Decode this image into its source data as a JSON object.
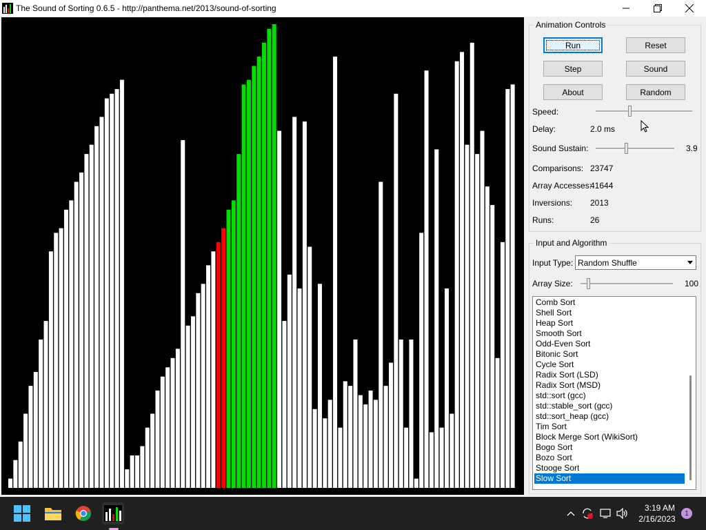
{
  "window": {
    "title": "The Sound of Sorting 0.6.5 - http://panthema.net/2013/sound-of-sorting",
    "app_icon": "sound-of-sorting-icon",
    "controls": [
      "minimize-icon",
      "maximize-icon",
      "close-icon"
    ]
  },
  "colors": {
    "background": "#000000",
    "bar_default": "#ffffff",
    "bar_red": "#ff0000",
    "bar_green": "#00dd00",
    "selection": "#0078d7"
  },
  "visualization": {
    "bars": [
      {
        "v": 2,
        "c": "w"
      },
      {
        "v": 6,
        "c": "w"
      },
      {
        "v": 10,
        "c": "w"
      },
      {
        "v": 16,
        "c": "w"
      },
      {
        "v": 22,
        "c": "w"
      },
      {
        "v": 25,
        "c": "w"
      },
      {
        "v": 32,
        "c": "w"
      },
      {
        "v": 36,
        "c": "w"
      },
      {
        "v": 51,
        "c": "w"
      },
      {
        "v": 55,
        "c": "w"
      },
      {
        "v": 56,
        "c": "w"
      },
      {
        "v": 60,
        "c": "w"
      },
      {
        "v": 62,
        "c": "w"
      },
      {
        "v": 66,
        "c": "w"
      },
      {
        "v": 68,
        "c": "w"
      },
      {
        "v": 72,
        "c": "w"
      },
      {
        "v": 74,
        "c": "w"
      },
      {
        "v": 78,
        "c": "w"
      },
      {
        "v": 80,
        "c": "w"
      },
      {
        "v": 84,
        "c": "w"
      },
      {
        "v": 85,
        "c": "w"
      },
      {
        "v": 86,
        "c": "w"
      },
      {
        "v": 88,
        "c": "w"
      },
      {
        "v": 4,
        "c": "w"
      },
      {
        "v": 7,
        "c": "w"
      },
      {
        "v": 7,
        "c": "w"
      },
      {
        "v": 9,
        "c": "w"
      },
      {
        "v": 13,
        "c": "w"
      },
      {
        "v": 16,
        "c": "w"
      },
      {
        "v": 21,
        "c": "w"
      },
      {
        "v": 24,
        "c": "w"
      },
      {
        "v": 26,
        "c": "w"
      },
      {
        "v": 28,
        "c": "w"
      },
      {
        "v": 30,
        "c": "w"
      },
      {
        "v": 75,
        "c": "w"
      },
      {
        "v": 35,
        "c": "w"
      },
      {
        "v": 37,
        "c": "w"
      },
      {
        "v": 42,
        "c": "w"
      },
      {
        "v": 44,
        "c": "w"
      },
      {
        "v": 48,
        "c": "w"
      },
      {
        "v": 51,
        "c": "w"
      },
      {
        "v": 53,
        "c": "r"
      },
      {
        "v": 56,
        "c": "r"
      },
      {
        "v": 60,
        "c": "g"
      },
      {
        "v": 62,
        "c": "g"
      },
      {
        "v": 72,
        "c": "g"
      },
      {
        "v": 87,
        "c": "g"
      },
      {
        "v": 88,
        "c": "g"
      },
      {
        "v": 91,
        "c": "g"
      },
      {
        "v": 93,
        "c": "g"
      },
      {
        "v": 96,
        "c": "g"
      },
      {
        "v": 99,
        "c": "g"
      },
      {
        "v": 100,
        "c": "g"
      },
      {
        "v": 77,
        "c": "w"
      },
      {
        "v": 36,
        "c": "w"
      },
      {
        "v": 46,
        "c": "w"
      },
      {
        "v": 80,
        "c": "w"
      },
      {
        "v": 43,
        "c": "w"
      },
      {
        "v": 79,
        "c": "w"
      },
      {
        "v": 52,
        "c": "w"
      },
      {
        "v": 17,
        "c": "w"
      },
      {
        "v": 44,
        "c": "w"
      },
      {
        "v": 15,
        "c": "w"
      },
      {
        "v": 19,
        "c": "w"
      },
      {
        "v": 93,
        "c": "w"
      },
      {
        "v": 13,
        "c": "w"
      },
      {
        "v": 23,
        "c": "w"
      },
      {
        "v": 22,
        "c": "w"
      },
      {
        "v": 32,
        "c": "w"
      },
      {
        "v": 20,
        "c": "w"
      },
      {
        "v": 18,
        "c": "w"
      },
      {
        "v": 21,
        "c": "w"
      },
      {
        "v": 19,
        "c": "w"
      },
      {
        "v": 66,
        "c": "w"
      },
      {
        "v": 22,
        "c": "w"
      },
      {
        "v": 27,
        "c": "w"
      },
      {
        "v": 85,
        "c": "w"
      },
      {
        "v": 32,
        "c": "w"
      },
      {
        "v": 13,
        "c": "w"
      },
      {
        "v": 32,
        "c": "w"
      },
      {
        "v": 2,
        "c": "w"
      },
      {
        "v": 55,
        "c": "w"
      },
      {
        "v": 90,
        "c": "w"
      },
      {
        "v": 12,
        "c": "w"
      },
      {
        "v": 73,
        "c": "w"
      },
      {
        "v": 13,
        "c": "w"
      },
      {
        "v": 43,
        "c": "w"
      },
      {
        "v": 16,
        "c": "w"
      },
      {
        "v": 92,
        "c": "w"
      },
      {
        "v": 94,
        "c": "w"
      },
      {
        "v": 74,
        "c": "w"
      },
      {
        "v": 96,
        "c": "w"
      },
      {
        "v": 72,
        "c": "w"
      },
      {
        "v": 77,
        "c": "w"
      },
      {
        "v": 65,
        "c": "w"
      },
      {
        "v": 61,
        "c": "w"
      },
      {
        "v": 28,
        "c": "w"
      },
      {
        "v": 53,
        "c": "w"
      },
      {
        "v": 86,
        "c": "w"
      },
      {
        "v": 87,
        "c": "w"
      }
    ],
    "max_value": 100
  },
  "animation_controls": {
    "title": "Animation Controls",
    "buttons": {
      "run": "Run",
      "reset": "Reset",
      "step": "Step",
      "sound": "Sound",
      "about": "About",
      "random": "Random"
    },
    "speed_label": "Speed:",
    "speed_level": 0.35,
    "delay_label": "Delay:",
    "delay_value": "2.0 ms",
    "sustain_label": "Sound Sustain:",
    "sustain_value": "3.9",
    "sustain_level": 0.39,
    "stats": [
      {
        "label": "Comparisons:",
        "value": "23747"
      },
      {
        "label": "Array Accesses:",
        "value": "41644"
      },
      {
        "label": "Inversions:",
        "value": "2013"
      },
      {
        "label": "Runs:",
        "value": "26"
      }
    ]
  },
  "input_algorithm": {
    "title": "Input and Algorithm",
    "input_type_label": "Input Type:",
    "input_type_value": "Random Shuffle",
    "array_size_label": "Array Size:",
    "array_size_value": "100",
    "array_size_level": 0.08,
    "algorithms": [
      "Comb Sort",
      "Shell Sort",
      "Heap Sort",
      "Smooth Sort",
      "Odd-Even Sort",
      "Bitonic Sort",
      "Cycle Sort",
      "Radix Sort (LSD)",
      "Radix Sort (MSD)",
      "std::sort (gcc)",
      "std::stable_sort (gcc)",
      "std::sort_heap (gcc)",
      "Tim Sort",
      "Block Merge Sort (WikiSort)",
      "Bogo Sort",
      "Bozo Sort",
      "Stooge Sort",
      "Slow Sort"
    ],
    "selected_index": 17
  },
  "taskbar": {
    "icons": [
      "windows-start-icon",
      "file-explorer-icon",
      "chrome-icon",
      "sound-of-sorting-icon"
    ],
    "time": "3:19 AM",
    "date": "2/16/2023",
    "notification_count": "1"
  }
}
